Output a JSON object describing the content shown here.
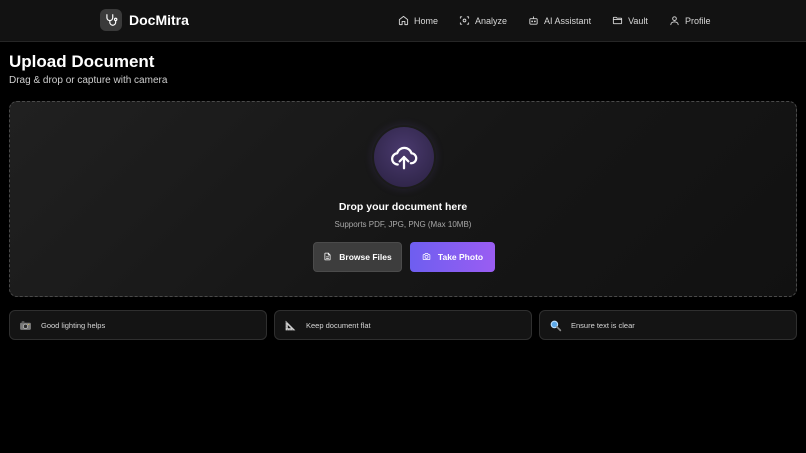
{
  "brand": {
    "name": "DocMitra",
    "logo_icon": "stethoscope-icon"
  },
  "nav": {
    "items": [
      {
        "label": "Home",
        "icon": "home-icon"
      },
      {
        "label": "Analyze",
        "icon": "scan-icon"
      },
      {
        "label": "AI Assistant",
        "icon": "bot-icon"
      },
      {
        "label": "Vault",
        "icon": "folder-icon"
      },
      {
        "label": "Profile",
        "icon": "user-icon"
      }
    ]
  },
  "page": {
    "title": "Upload Document",
    "subtitle": "Drag & drop or capture with camera"
  },
  "dropzone": {
    "icon": "cloud-upload-icon",
    "title": "Drop your document here",
    "hint": "Supports PDF, JPG, PNG (Max 10MB)",
    "browse_label": "Browse Files",
    "photo_label": "Take Photo"
  },
  "tips": [
    {
      "icon": "camera-emoji-icon",
      "text": "Good lighting helps"
    },
    {
      "icon": "triangle-ruler-icon",
      "text": "Keep document flat"
    },
    {
      "icon": "magnifier-icon",
      "text": "Ensure text is clear"
    }
  ],
  "colors": {
    "background": "#000000",
    "navbar": "#121212",
    "accent_start": "#6e5ef0",
    "accent_end": "#9a5df2",
    "upload_circle": "#3a2d5a"
  }
}
